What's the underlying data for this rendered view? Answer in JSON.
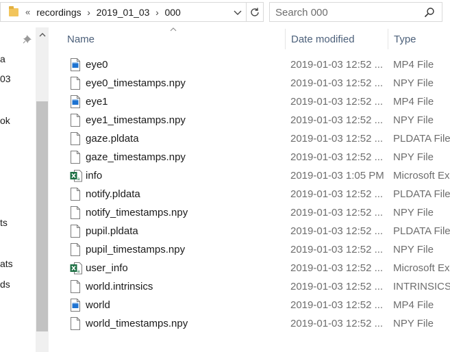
{
  "address": {
    "overflow_label": "«",
    "crumbs": [
      "recordings",
      "2019_01_03",
      "000"
    ]
  },
  "search": {
    "placeholder": "Search 000"
  },
  "nav_pane": {
    "items": [
      "a",
      "03",
      "ok",
      "ts",
      "ats",
      "ds"
    ]
  },
  "columns": {
    "name": "Name",
    "date": "Date modified",
    "type": "Type"
  },
  "files": [
    {
      "name": "eye0",
      "date": "2019-01-03 12:52 ...",
      "type": "MP4 File",
      "icon": "video-file-icon"
    },
    {
      "name": "eye0_timestamps.npy",
      "date": "2019-01-03 12:52 ...",
      "type": "NPY File",
      "icon": "blank-file-icon"
    },
    {
      "name": "eye1",
      "date": "2019-01-03 12:52 ...",
      "type": "MP4 File",
      "icon": "video-file-icon"
    },
    {
      "name": "eye1_timestamps.npy",
      "date": "2019-01-03 12:52 ...",
      "type": "NPY File",
      "icon": "blank-file-icon"
    },
    {
      "name": "gaze.pldata",
      "date": "2019-01-03 12:52 ...",
      "type": "PLDATA File",
      "icon": "blank-file-icon"
    },
    {
      "name": "gaze_timestamps.npy",
      "date": "2019-01-03 12:52 ...",
      "type": "NPY File",
      "icon": "blank-file-icon"
    },
    {
      "name": "info",
      "date": "2019-01-03 1:05 PM",
      "type": "Microsoft Ex",
      "icon": "excel-file-icon"
    },
    {
      "name": "notify.pldata",
      "date": "2019-01-03 12:52 ...",
      "type": "PLDATA File",
      "icon": "blank-file-icon"
    },
    {
      "name": "notify_timestamps.npy",
      "date": "2019-01-03 12:52 ...",
      "type": "NPY File",
      "icon": "blank-file-icon"
    },
    {
      "name": "pupil.pldata",
      "date": "2019-01-03 12:52 ...",
      "type": "PLDATA File",
      "icon": "blank-file-icon"
    },
    {
      "name": "pupil_timestamps.npy",
      "date": "2019-01-03 12:52 ...",
      "type": "NPY File",
      "icon": "blank-file-icon"
    },
    {
      "name": "user_info",
      "date": "2019-01-03 12:52 ...",
      "type": "Microsoft Ex",
      "icon": "excel-file-icon"
    },
    {
      "name": "world.intrinsics",
      "date": "2019-01-03 12:52 ...",
      "type": "INTRINSICS F",
      "icon": "blank-file-icon"
    },
    {
      "name": "world",
      "date": "2019-01-03 12:52 ...",
      "type": "MP4 File",
      "icon": "video-file-icon"
    },
    {
      "name": "world_timestamps.npy",
      "date": "2019-01-03 12:52 ...",
      "type": "NPY File",
      "icon": "blank-file-icon"
    }
  ],
  "colors": {
    "header_text": "#4c607a",
    "secondary_text": "#6d6d6d",
    "excel_green": "#1d7044",
    "video_blue": "#1e73d1"
  }
}
